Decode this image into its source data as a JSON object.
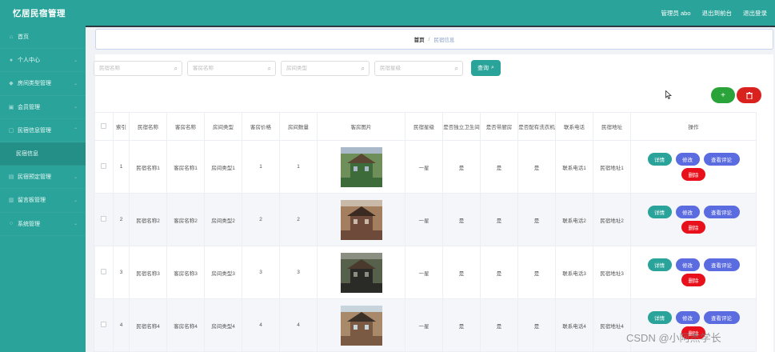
{
  "app": {
    "title": "忆居民宿管理"
  },
  "header": {
    "admin_label": "管理员 abo",
    "back_label": "退出到前台",
    "logout_label": "退出登录"
  },
  "sidebar": {
    "items": [
      {
        "label": "首页",
        "icon": "home-icon"
      },
      {
        "label": "个人中心",
        "icon": "user-icon"
      },
      {
        "label": "房间类型管理",
        "icon": "tag-icon"
      },
      {
        "label": "会员管理",
        "icon": "member-icon"
      },
      {
        "label": "民宿信息管理",
        "icon": "doc-icon"
      },
      {
        "label": "民宿信息",
        "icon": ""
      },
      {
        "label": "民宿预定管理",
        "icon": "calendar-icon"
      },
      {
        "label": "留言板管理",
        "icon": "message-icon"
      },
      {
        "label": "系统管理",
        "icon": "gear-icon"
      }
    ]
  },
  "breadcrumb": {
    "home": "首页",
    "separator": "/",
    "current": "民宿信息"
  },
  "search": {
    "fields": [
      {
        "placeholder": "民宿名称"
      },
      {
        "placeholder": "客房名称"
      },
      {
        "placeholder": "房间类型"
      },
      {
        "placeholder": "民宿星级"
      }
    ],
    "query_label": "查询"
  },
  "actions": {
    "add_icon": "+",
    "delete_icon": "trash-icon"
  },
  "table": {
    "headers": [
      "",
      "索引",
      "民宿名称",
      "客房名称",
      "房间类型",
      "客房价格",
      "房间数量",
      "客房图片",
      "民宿星级",
      "是否独立卫生间",
      "是否带厨房",
      "是否配有洗衣机",
      "联系电话",
      "民宿地址",
      "操作"
    ],
    "rows": [
      {
        "index": "1",
        "name": "民宿名称1",
        "room": "客房名称1",
        "type": "房间类型1",
        "price": "1",
        "count": "1",
        "star": "一星",
        "bath": "是",
        "kitchen": "是",
        "washer": "是",
        "phone": "联系电话1",
        "address": "民宿地址1"
      },
      {
        "index": "2",
        "name": "民宿名称2",
        "room": "客房名称2",
        "type": "房间类型2",
        "price": "2",
        "count": "2",
        "star": "一星",
        "bath": "是",
        "kitchen": "是",
        "washer": "是",
        "phone": "联系电话2",
        "address": "民宿地址2"
      },
      {
        "index": "3",
        "name": "民宿名称3",
        "room": "客房名称3",
        "type": "房间类型3",
        "price": "3",
        "count": "3",
        "star": "一星",
        "bath": "是",
        "kitchen": "是",
        "washer": "是",
        "phone": "联系电话3",
        "address": "民宿地址3"
      },
      {
        "index": "4",
        "name": "民宿名称4",
        "room": "客房名称4",
        "type": "房间类型4",
        "price": "4",
        "count": "4",
        "star": "一星",
        "bath": "是",
        "kitchen": "是",
        "washer": "是",
        "phone": "联系电话4",
        "address": "民宿地址4"
      }
    ],
    "ops": {
      "detail": "详情",
      "edit": "修改",
      "review": "查看评论",
      "delete": "删除"
    }
  },
  "watermark": "CSDN @小阿杰学长",
  "colors": {
    "primary": "#2aa39a",
    "edit": "#5b6ce0",
    "danger": "#e8101a",
    "add": "#2aa33a"
  }
}
